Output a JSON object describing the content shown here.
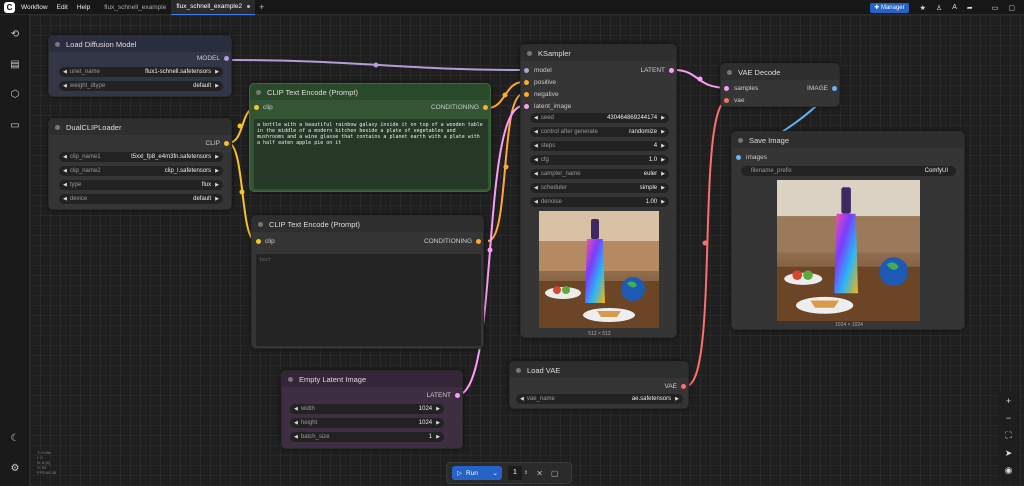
{
  "topbar": {
    "menu": [
      "Workflow",
      "Edit",
      "Help"
    ],
    "tabs": [
      {
        "label": "flux_schnell_example",
        "active": false
      },
      {
        "label": "flux_schnell_example2",
        "active": true
      }
    ],
    "manager_label": "Manager"
  },
  "stats": [
    "T: 0.00s",
    "I: 0",
    "N: 8 [8]",
    "V: 93",
    "FPS:60.38"
  ],
  "nodes": {
    "load_diffusion": {
      "title": "Load Diffusion Model",
      "output": "MODEL",
      "widgets": [
        {
          "label": "unet_name",
          "value": "flux1-schnell.safetensors"
        },
        {
          "label": "weight_dtype",
          "value": "default"
        }
      ]
    },
    "dual_clip": {
      "title": "DualCLIPLoader",
      "output": "CLIP",
      "widgets": [
        {
          "label": "clip_name1",
          "value": "t5xxl_fp8_e4m3fn.safetensors"
        },
        {
          "label": "clip_name2",
          "value": "clip_l.safetensors"
        },
        {
          "label": "type",
          "value": "flux"
        },
        {
          "label": "device",
          "value": "default"
        }
      ]
    },
    "clip_pos": {
      "title": "CLIP Text Encode (Prompt)",
      "input": "clip",
      "output": "CONDITIONING",
      "text": "a bottle with a beautiful rainbow galaxy inside it on top of a wooden table in the middle of a modern kitchen beside a plate of vegetables and mushrooms and a wine glasse that contains a planet earth with a plate with a half eaten apple pie on it"
    },
    "clip_neg": {
      "title": "CLIP Text Encode (Prompt)",
      "input": "clip",
      "output": "CONDITIONING",
      "placeholder": "text"
    },
    "empty_latent": {
      "title": "Empty Latent Image",
      "output": "LATENT",
      "widgets": [
        {
          "label": "width",
          "value": "1024"
        },
        {
          "label": "height",
          "value": "1024"
        },
        {
          "label": "batch_size",
          "value": "1"
        }
      ]
    },
    "ksampler": {
      "title": "KSampler",
      "inputs": [
        "model",
        "positive",
        "negative",
        "latent_image"
      ],
      "output": "LATENT",
      "widgets": [
        {
          "label": "seed",
          "value": "430464869244174"
        },
        {
          "label": "control after generate",
          "value": "randomize"
        },
        {
          "label": "steps",
          "value": "4"
        },
        {
          "label": "cfg",
          "value": "1.0"
        },
        {
          "label": "sampler_name",
          "value": "euler"
        },
        {
          "label": "scheduler",
          "value": "simple"
        },
        {
          "label": "denoise",
          "value": "1.00"
        }
      ],
      "preview_caption": "512 × 512"
    },
    "vae_decode": {
      "title": "VAE Decode",
      "inputs": [
        "samples",
        "vae"
      ],
      "output": "IMAGE"
    },
    "save_image": {
      "title": "Save Image",
      "input": "images",
      "widgets": [
        {
          "label": "filename_prefix",
          "value": "ComfyUI"
        }
      ],
      "preview_caption": "1024 × 1024"
    },
    "load_vae": {
      "title": "Load VAE",
      "output": "VAE",
      "widgets": [
        {
          "label": "vae_name",
          "value": "ae.safetensors"
        }
      ]
    }
  },
  "run_bar": {
    "run_label": "Run",
    "count": "1"
  },
  "colors": {
    "model_link": "#b39ddb",
    "clip_link": "#f7c427",
    "cond_link": "#ffa931",
    "latent_link": "#ff9cf9",
    "vae_link": "#ff6e6e",
    "image_link": "#64b5f6",
    "accent": "#2563c8"
  }
}
